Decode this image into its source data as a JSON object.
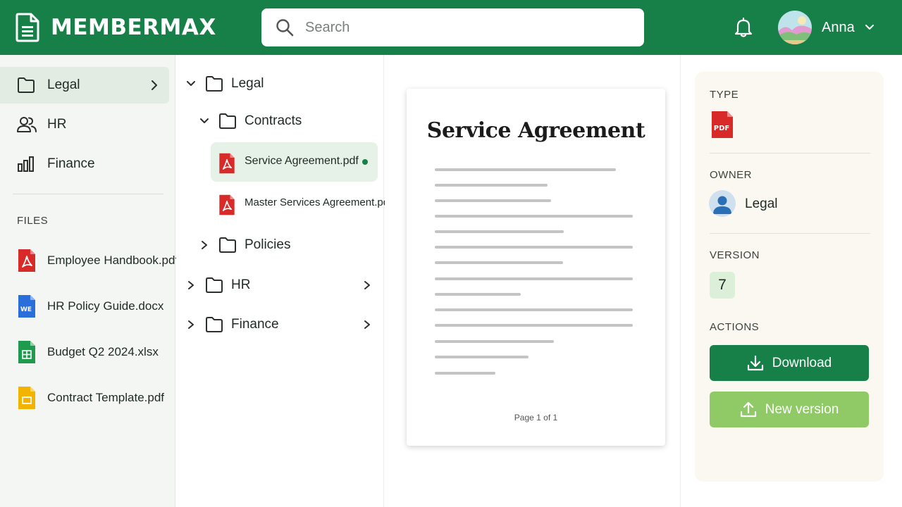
{
  "header": {
    "app_name": "MEMBERMAX",
    "search_placeholder": "Search",
    "user_name": "Anna"
  },
  "sidebar": {
    "nav": [
      {
        "label": "Legal",
        "icon": "folder-icon",
        "active": true
      },
      {
        "label": "HR",
        "icon": "users-icon",
        "active": false
      },
      {
        "label": "Finance",
        "icon": "bar-chart-icon",
        "active": false
      }
    ],
    "files_heading": "FILES",
    "files": [
      {
        "label": "Employee Handbook.pdf",
        "icon": "pdf-file-icon"
      },
      {
        "label": "HR Policy Guide.docx",
        "icon": "word-file-icon"
      },
      {
        "label": "Budget Q2 2024.xlsx",
        "icon": "sheet-file-icon"
      },
      {
        "label": "Contract Template.pdf",
        "icon": "slides-file-icon"
      }
    ]
  },
  "tree": {
    "root": "Legal",
    "contracts": "Contracts",
    "files": [
      {
        "label": "Service Agreement.pdf",
        "selected": true
      },
      {
        "label": "Master Services Agreement.pdf",
        "selected": false
      }
    ],
    "policies": "Policies",
    "hr": "HR",
    "finance": "Finance"
  },
  "preview": {
    "title": "Service Agreement",
    "page_label": "Page 1 of 1"
  },
  "details": {
    "type_heading": "TYPE",
    "type_icon_label": "PDF",
    "owner_heading": "OWNER",
    "owner_name": "Legal",
    "version_heading": "VERSION",
    "version": "7",
    "actions_heading": "ACTIONS",
    "download_label": "Download",
    "new_version_label": "New version"
  },
  "colors": {
    "brand": "#168048",
    "accent_light": "#8fca66",
    "pdf_red": "#d92a2a"
  }
}
